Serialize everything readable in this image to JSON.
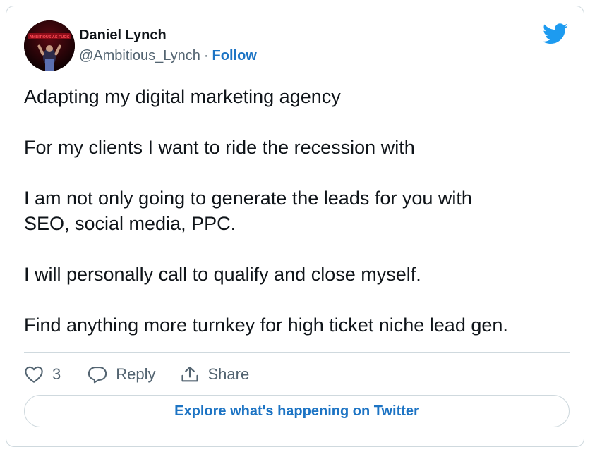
{
  "author": {
    "name": "Daniel Lynch",
    "handle": "@Ambitious_Lynch",
    "separator": "·",
    "follow_label": "Follow",
    "avatar_text": "AMBITIOUS AS FUCK"
  },
  "tweet": {
    "paragraphs": [
      "Adapting my digital marketing agency",
      "For my clients I want to ride the recession with",
      "I am not only going to generate the leads for you with\nSEO, social media, PPC.",
      "I will personally call to qualify and close myself.",
      "Find anything more turnkey for high ticket niche lead gen."
    ]
  },
  "actions": {
    "like_count": "3",
    "reply_label": "Reply",
    "share_label": "Share"
  },
  "explore_label": "Explore what's happening on Twitter",
  "icons": {
    "brand": "twitter-bird-icon",
    "like": "heart-icon",
    "reply": "reply-bubble-icon",
    "share": "share-icon"
  },
  "colors": {
    "twitter_blue": "#1d9bf0",
    "link_blue": "#1d74c4",
    "text": "#0f1419",
    "secondary_text": "#536471",
    "border": "#cfd9de"
  }
}
